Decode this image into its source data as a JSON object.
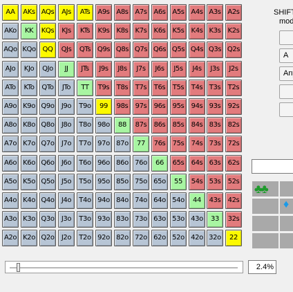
{
  "grid": {
    "colors": {
      "yellow": "#fcf900",
      "green": "#a8f5a2",
      "red": "#e27b7d",
      "blue": "#b7c5d5"
    },
    "rows": [
      [
        [
          "AA",
          "y"
        ],
        [
          "AKs",
          "y"
        ],
        [
          "AQs",
          "y"
        ],
        [
          "AJs",
          "y"
        ],
        [
          "ATs",
          "y"
        ],
        [
          "A9s",
          "r"
        ],
        [
          "A8s",
          "r"
        ],
        [
          "A7s",
          "r"
        ],
        [
          "A6s",
          "r"
        ],
        [
          "A5s",
          "r"
        ],
        [
          "A4s",
          "r"
        ],
        [
          "A3s",
          "r"
        ],
        [
          "A2s",
          "r"
        ]
      ],
      [
        [
          "AKo",
          "b"
        ],
        [
          "KK",
          "g"
        ],
        [
          "KQs",
          "y"
        ],
        [
          "KJs",
          "r"
        ],
        [
          "KTs",
          "r"
        ],
        [
          "K9s",
          "r"
        ],
        [
          "K8s",
          "r"
        ],
        [
          "K7s",
          "r"
        ],
        [
          "K6s",
          "r"
        ],
        [
          "K5s",
          "r"
        ],
        [
          "K4s",
          "r"
        ],
        [
          "K3s",
          "r"
        ],
        [
          "K2s",
          "r"
        ]
      ],
      [
        [
          "AQo",
          "b"
        ],
        [
          "KQo",
          "b"
        ],
        [
          "QQ",
          "y"
        ],
        [
          "QJs",
          "r"
        ],
        [
          "QTs",
          "r"
        ],
        [
          "Q9s",
          "r"
        ],
        [
          "Q8s",
          "r"
        ],
        [
          "Q7s",
          "r"
        ],
        [
          "Q6s",
          "r"
        ],
        [
          "Q5s",
          "r"
        ],
        [
          "Q4s",
          "r"
        ],
        [
          "Q3s",
          "r"
        ],
        [
          "Q2s",
          "r"
        ]
      ],
      [
        [
          "AJo",
          "b"
        ],
        [
          "KJo",
          "b"
        ],
        [
          "QJo",
          "b"
        ],
        [
          "JJ",
          "g"
        ],
        [
          "JTs",
          "r"
        ],
        [
          "J9s",
          "r"
        ],
        [
          "J8s",
          "r"
        ],
        [
          "J7s",
          "r"
        ],
        [
          "J6s",
          "r"
        ],
        [
          "J5s",
          "r"
        ],
        [
          "J4s",
          "r"
        ],
        [
          "J3s",
          "r"
        ],
        [
          "J2s",
          "r"
        ]
      ],
      [
        [
          "ATo",
          "b"
        ],
        [
          "KTo",
          "b"
        ],
        [
          "QTo",
          "b"
        ],
        [
          "JTo",
          "b"
        ],
        [
          "TT",
          "g"
        ],
        [
          "T9s",
          "r"
        ],
        [
          "T8s",
          "r"
        ],
        [
          "T7s",
          "r"
        ],
        [
          "T6s",
          "r"
        ],
        [
          "T5s",
          "r"
        ],
        [
          "T4s",
          "r"
        ],
        [
          "T3s",
          "r"
        ],
        [
          "T2s",
          "r"
        ]
      ],
      [
        [
          "A9o",
          "b"
        ],
        [
          "K9o",
          "b"
        ],
        [
          "Q9o",
          "b"
        ],
        [
          "J9o",
          "b"
        ],
        [
          "T9o",
          "b"
        ],
        [
          "99",
          "y"
        ],
        [
          "98s",
          "r"
        ],
        [
          "97s",
          "r"
        ],
        [
          "96s",
          "r"
        ],
        [
          "95s",
          "r"
        ],
        [
          "94s",
          "r"
        ],
        [
          "93s",
          "r"
        ],
        [
          "92s",
          "r"
        ]
      ],
      [
        [
          "A8o",
          "b"
        ],
        [
          "K8o",
          "b"
        ],
        [
          "Q8o",
          "b"
        ],
        [
          "J8o",
          "b"
        ],
        [
          "T8o",
          "b"
        ],
        [
          "98o",
          "b"
        ],
        [
          "88",
          "g"
        ],
        [
          "87s",
          "r"
        ],
        [
          "86s",
          "r"
        ],
        [
          "85s",
          "r"
        ],
        [
          "84s",
          "r"
        ],
        [
          "83s",
          "r"
        ],
        [
          "82s",
          "r"
        ]
      ],
      [
        [
          "A7o",
          "b"
        ],
        [
          "K7o",
          "b"
        ],
        [
          "Q7o",
          "b"
        ],
        [
          "J7o",
          "b"
        ],
        [
          "T7o",
          "b"
        ],
        [
          "97o",
          "b"
        ],
        [
          "87o",
          "b"
        ],
        [
          "77",
          "g"
        ],
        [
          "76s",
          "r"
        ],
        [
          "75s",
          "r"
        ],
        [
          "74s",
          "r"
        ],
        [
          "73s",
          "r"
        ],
        [
          "72s",
          "r"
        ]
      ],
      [
        [
          "A6o",
          "b"
        ],
        [
          "K6o",
          "b"
        ],
        [
          "Q6o",
          "b"
        ],
        [
          "J6o",
          "b"
        ],
        [
          "T6o",
          "b"
        ],
        [
          "96o",
          "b"
        ],
        [
          "86o",
          "b"
        ],
        [
          "76o",
          "b"
        ],
        [
          "66",
          "g"
        ],
        [
          "65s",
          "r"
        ],
        [
          "64s",
          "r"
        ],
        [
          "63s",
          "r"
        ],
        [
          "62s",
          "r"
        ]
      ],
      [
        [
          "A5o",
          "b"
        ],
        [
          "K5o",
          "b"
        ],
        [
          "Q5o",
          "b"
        ],
        [
          "J5o",
          "b"
        ],
        [
          "T5o",
          "b"
        ],
        [
          "95o",
          "b"
        ],
        [
          "85o",
          "b"
        ],
        [
          "75o",
          "b"
        ],
        [
          "65o",
          "b"
        ],
        [
          "55",
          "g"
        ],
        [
          "54s",
          "r"
        ],
        [
          "53s",
          "r"
        ],
        [
          "52s",
          "r"
        ]
      ],
      [
        [
          "A4o",
          "b"
        ],
        [
          "K4o",
          "b"
        ],
        [
          "Q4o",
          "b"
        ],
        [
          "J4o",
          "b"
        ],
        [
          "T4o",
          "b"
        ],
        [
          "94o",
          "b"
        ],
        [
          "84o",
          "b"
        ],
        [
          "74o",
          "b"
        ],
        [
          "64o",
          "b"
        ],
        [
          "54o",
          "b"
        ],
        [
          "44",
          "g"
        ],
        [
          "43s",
          "r"
        ],
        [
          "42s",
          "r"
        ]
      ],
      [
        [
          "A3o",
          "b"
        ],
        [
          "K3o",
          "b"
        ],
        [
          "Q3o",
          "b"
        ],
        [
          "J3o",
          "b"
        ],
        [
          "T3o",
          "b"
        ],
        [
          "93o",
          "b"
        ],
        [
          "83o",
          "b"
        ],
        [
          "73o",
          "b"
        ],
        [
          "63o",
          "b"
        ],
        [
          "53o",
          "b"
        ],
        [
          "43o",
          "b"
        ],
        [
          "33",
          "g"
        ],
        [
          "32s",
          "r"
        ]
      ],
      [
        [
          "A2o",
          "b"
        ],
        [
          "K2o",
          "b"
        ],
        [
          "Q2o",
          "b"
        ],
        [
          "J2o",
          "b"
        ],
        [
          "T2o",
          "b"
        ],
        [
          "92o",
          "b"
        ],
        [
          "82o",
          "b"
        ],
        [
          "72o",
          "b"
        ],
        [
          "62o",
          "b"
        ],
        [
          "52o",
          "b"
        ],
        [
          "42o",
          "b"
        ],
        [
          "32o",
          "b"
        ],
        [
          "22",
          "y"
        ]
      ]
    ]
  },
  "side_panel": {
    "shift_label": "SHIFT",
    "mode_label": "mod",
    "btn_1": "",
    "btn_2": "A",
    "btn_3": "Any",
    "btn_4": "",
    "btn_5": ""
  },
  "suits": {
    "clubs": "♣♣",
    "diamond": "♦"
  },
  "range_slider": {
    "value_pct": 2.4,
    "display": "2.4%"
  }
}
